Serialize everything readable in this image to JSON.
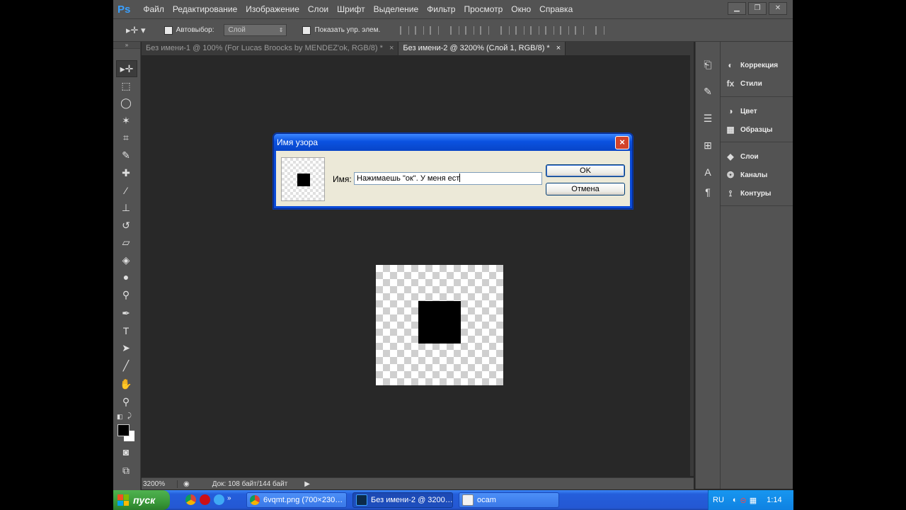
{
  "app": {
    "logo": "Ps"
  },
  "menu": [
    "Файл",
    "Редактирование",
    "Изображение",
    "Слои",
    "Шрифт",
    "Выделение",
    "Фильтр",
    "Просмотр",
    "Окно",
    "Справка"
  ],
  "options_bar": {
    "autoselect_label": "Автовыбор:",
    "autoselect_value": "Слой",
    "show_controls_label": "Показать упр. элем."
  },
  "tabs": [
    {
      "label": "Без имени-1 @ 100% (For Lucas Broocks by MENDEZ'ok, RGB/8) *",
      "close": "×",
      "active": false
    },
    {
      "label": "Без имени-2 @ 3200% (Слой 1, RGB/8) *",
      "close": "×",
      "active": true
    }
  ],
  "dialog": {
    "title": "Имя узора",
    "close": "×",
    "name_label": "Имя:",
    "name_value": "Нажимаешь \"ок\". У меня ест",
    "ok_label": "OK",
    "cancel_label": "Отмена"
  },
  "status_bar": {
    "zoom": "3200%",
    "doc_info": "Док: 108 байт/144 байт"
  },
  "right_panels": [
    {
      "label": "Коррекция",
      "icon": "adjustments-icon"
    },
    {
      "label": "Стили",
      "icon": "styles-icon"
    },
    {
      "label": "Цвет",
      "icon": "color-icon"
    },
    {
      "label": "Образцы",
      "icon": "swatches-icon"
    },
    {
      "label": "Слои",
      "icon": "layers-icon"
    },
    {
      "label": "Каналы",
      "icon": "channels-icon"
    },
    {
      "label": "Контуры",
      "icon": "paths-icon"
    }
  ],
  "taskbar": {
    "start_label": "пуск",
    "items": [
      {
        "label": "6vqmt.png (700×230…",
        "icon": "chrome-icon",
        "active": false
      },
      {
        "label": "Без имени-2 @ 3200…",
        "icon": "photoshop-icon",
        "active": true
      },
      {
        "label": "ocam",
        "icon": "ocam-icon",
        "active": false
      }
    ],
    "lang": "RU",
    "clock": "1:14"
  },
  "colors": {
    "ps_dark": "#282828",
    "ps_panel": "#535353",
    "xp_blue": "#245edb",
    "xp_start_green": "#3a9a3a",
    "ps_logo_blue": "#3aa0ff"
  }
}
